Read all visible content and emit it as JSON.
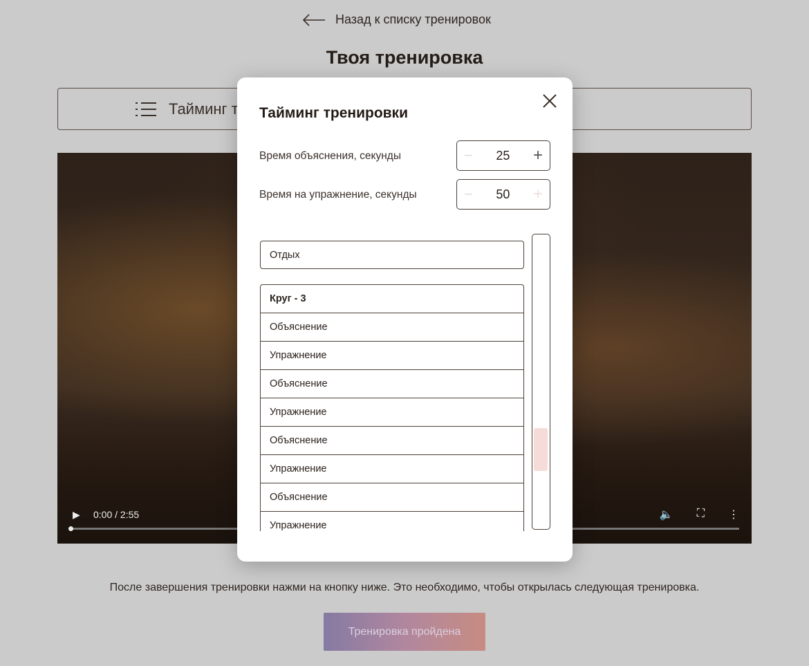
{
  "nav": {
    "back_label": "Назад к списку тренировок"
  },
  "page": {
    "title": "Твоя тренировка",
    "timing_button": "Тайминг тренировки"
  },
  "video": {
    "time": "0:00 / 2:55",
    "progress": 0
  },
  "footer": {
    "note": "После завершения тренировки нажми на кнопку ниже. Это необходимо, чтобы открылась следующая тренировка.",
    "done_button": "Тренировка пройдена"
  },
  "modal": {
    "title": "Тайминг тренировки",
    "explain": {
      "label": "Время объяснения, секунды",
      "value": "25"
    },
    "exercise": {
      "label": "Время на упражнение, секунды",
      "value": "50"
    },
    "rest": "Отдых",
    "round": "Круг - 3",
    "items": [
      "Объяснение",
      "Упражнение",
      "Объяснение",
      "Упражнение",
      "Объяснение",
      "Упражнение",
      "Объяснение",
      "Упражнение"
    ]
  },
  "colors": {
    "accent_start": "#857aa3",
    "accent_end": "#c78c82",
    "scroll_thumb": "#f5dcd8"
  }
}
